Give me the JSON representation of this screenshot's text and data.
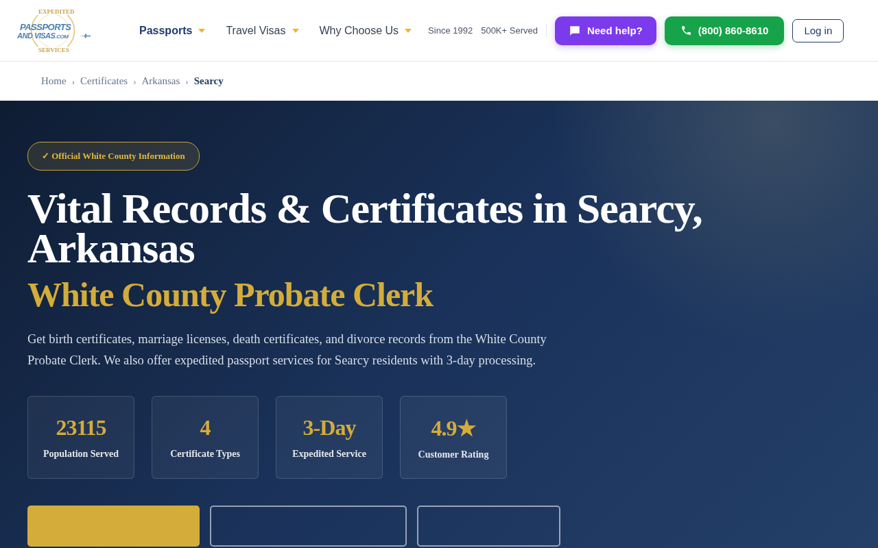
{
  "logo": {
    "top": "EXPEDITED",
    "line1": "PASSPORTS",
    "line2": "AND VISAS",
    "suffix": ".COM",
    "bottom": "SERVICES"
  },
  "nav": [
    {
      "label": "Passports",
      "selected": true
    },
    {
      "label": "Travel Visas",
      "selected": false
    },
    {
      "label": "Why Choose Us",
      "selected": false
    }
  ],
  "badges": [
    "Since 1992",
    "500K+ Served"
  ],
  "help_button": "Need help?",
  "phone_button": "(800) 860-8610",
  "login_button": "Log in",
  "breadcrumb": [
    {
      "label": "Home",
      "selected": false
    },
    {
      "label": "Certificates",
      "selected": false
    },
    {
      "label": "Arkansas",
      "selected": false
    },
    {
      "label": "Searcy",
      "selected": true
    }
  ],
  "breadcrumb_separator": "›",
  "hero": {
    "tag": "✓ Official White County Information",
    "title": "Vital Records & Certificates in Searcy, Arkansas",
    "subtitle": "White County Probate Clerk",
    "description": "Get birth certificates, marriage licenses, death certificates, and divorce records from the White County Probate Clerk. We also offer expedited passport services for Searcy residents with 3-day processing.",
    "stats": [
      {
        "value": "23115",
        "label": "Population Served"
      },
      {
        "value": "4",
        "label": "Certificate Types"
      },
      {
        "value": "3-Day",
        "label": "Expedited Service"
      },
      {
        "value": "4.9★",
        "label": "Customer Rating"
      }
    ],
    "buttons": [
      {
        "kind": "primary"
      },
      {
        "kind": "outline"
      },
      {
        "kind": "outline"
      }
    ]
  }
}
